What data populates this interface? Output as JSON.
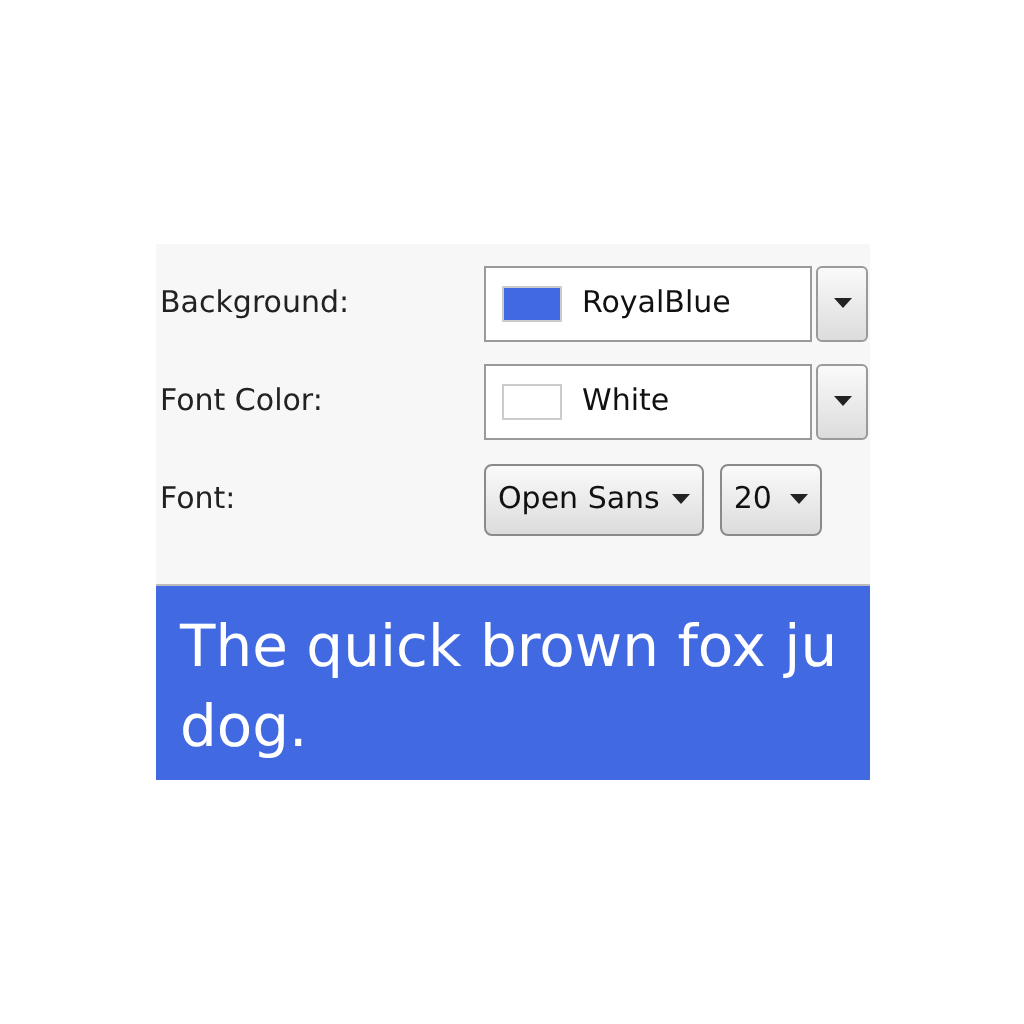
{
  "settings": [
    {
      "kind": "color",
      "label": "Background:",
      "value": "RoyalBlue",
      "color": "#4169e1"
    },
    {
      "kind": "color",
      "label": "Font Color:",
      "value": "White",
      "color": "#ffffff"
    },
    {
      "kind": "font",
      "label": "Font:",
      "family": "Open Sans",
      "size": "20"
    }
  ],
  "preview": {
    "lines": [
      "The quick brown fox ju",
      "dog."
    ]
  }
}
